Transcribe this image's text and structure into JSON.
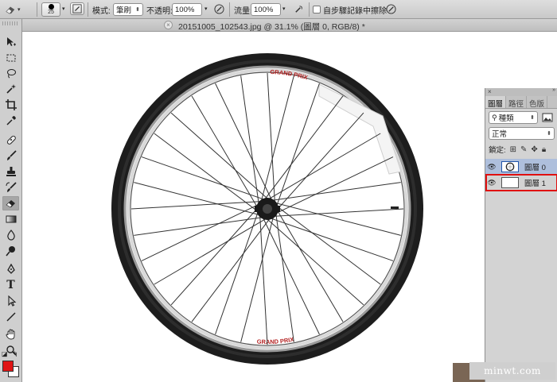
{
  "options": {
    "brush_size": "25",
    "mode_label": "模式:",
    "mode_value": "筆刷",
    "opacity_label": "不透明:",
    "opacity_value": "100%",
    "flow_label": "流量:",
    "flow_value": "100%",
    "erase_history_label": "自步驟記錄中擦除",
    "erase_history_checked": false
  },
  "document": {
    "title": "20151005_102543.jpg @ 31.1% (圖層 0, RGB/8) *",
    "close_glyph": "×"
  },
  "tools": [
    {
      "name": "move-tool",
      "active": false
    },
    {
      "name": "marquee-tool",
      "active": false
    },
    {
      "name": "lasso-tool",
      "active": false
    },
    {
      "name": "magic-wand-tool",
      "active": false
    },
    {
      "name": "crop-tool",
      "active": false
    },
    {
      "name": "eyedropper-tool",
      "active": false
    },
    {
      "name": "healing-brush-tool",
      "active": false
    },
    {
      "name": "brush-tool",
      "active": false
    },
    {
      "name": "clone-stamp-tool",
      "active": false
    },
    {
      "name": "history-brush-tool",
      "active": false
    },
    {
      "name": "eraser-tool",
      "active": true
    },
    {
      "name": "gradient-tool",
      "active": false
    },
    {
      "name": "blur-tool",
      "active": false
    },
    {
      "name": "dodge-tool",
      "active": false
    },
    {
      "name": "pen-tool",
      "active": false
    },
    {
      "name": "type-tool",
      "active": false
    },
    {
      "name": "path-selection-tool",
      "active": false
    },
    {
      "name": "line-tool",
      "active": false
    },
    {
      "name": "hand-tool",
      "active": false
    },
    {
      "name": "zoom-tool",
      "active": false
    }
  ],
  "type_tool_glyph": "T",
  "colors": {
    "foreground": "#e01414",
    "background": "#ffffff",
    "selection_highlight": "#e01010",
    "active_layer": "#aebfdc"
  },
  "layers_panel": {
    "close_glyph": "×",
    "tabs": [
      "圖層",
      "路徑",
      "色版"
    ],
    "active_tab": 0,
    "filter_value": "種類",
    "blend_value": "正常",
    "lock_label": "鎖定:",
    "layers": [
      {
        "name": "圖層 0",
        "selected": true,
        "visible": true
      },
      {
        "name": "圖層 1",
        "selected": false,
        "visible": true,
        "highlighted": true
      }
    ]
  },
  "wheel": {
    "rim_text_top": "GRAND PRIX",
    "rim_text_bottom": "GRAND PRIX"
  },
  "watermark": "minwt.com"
}
